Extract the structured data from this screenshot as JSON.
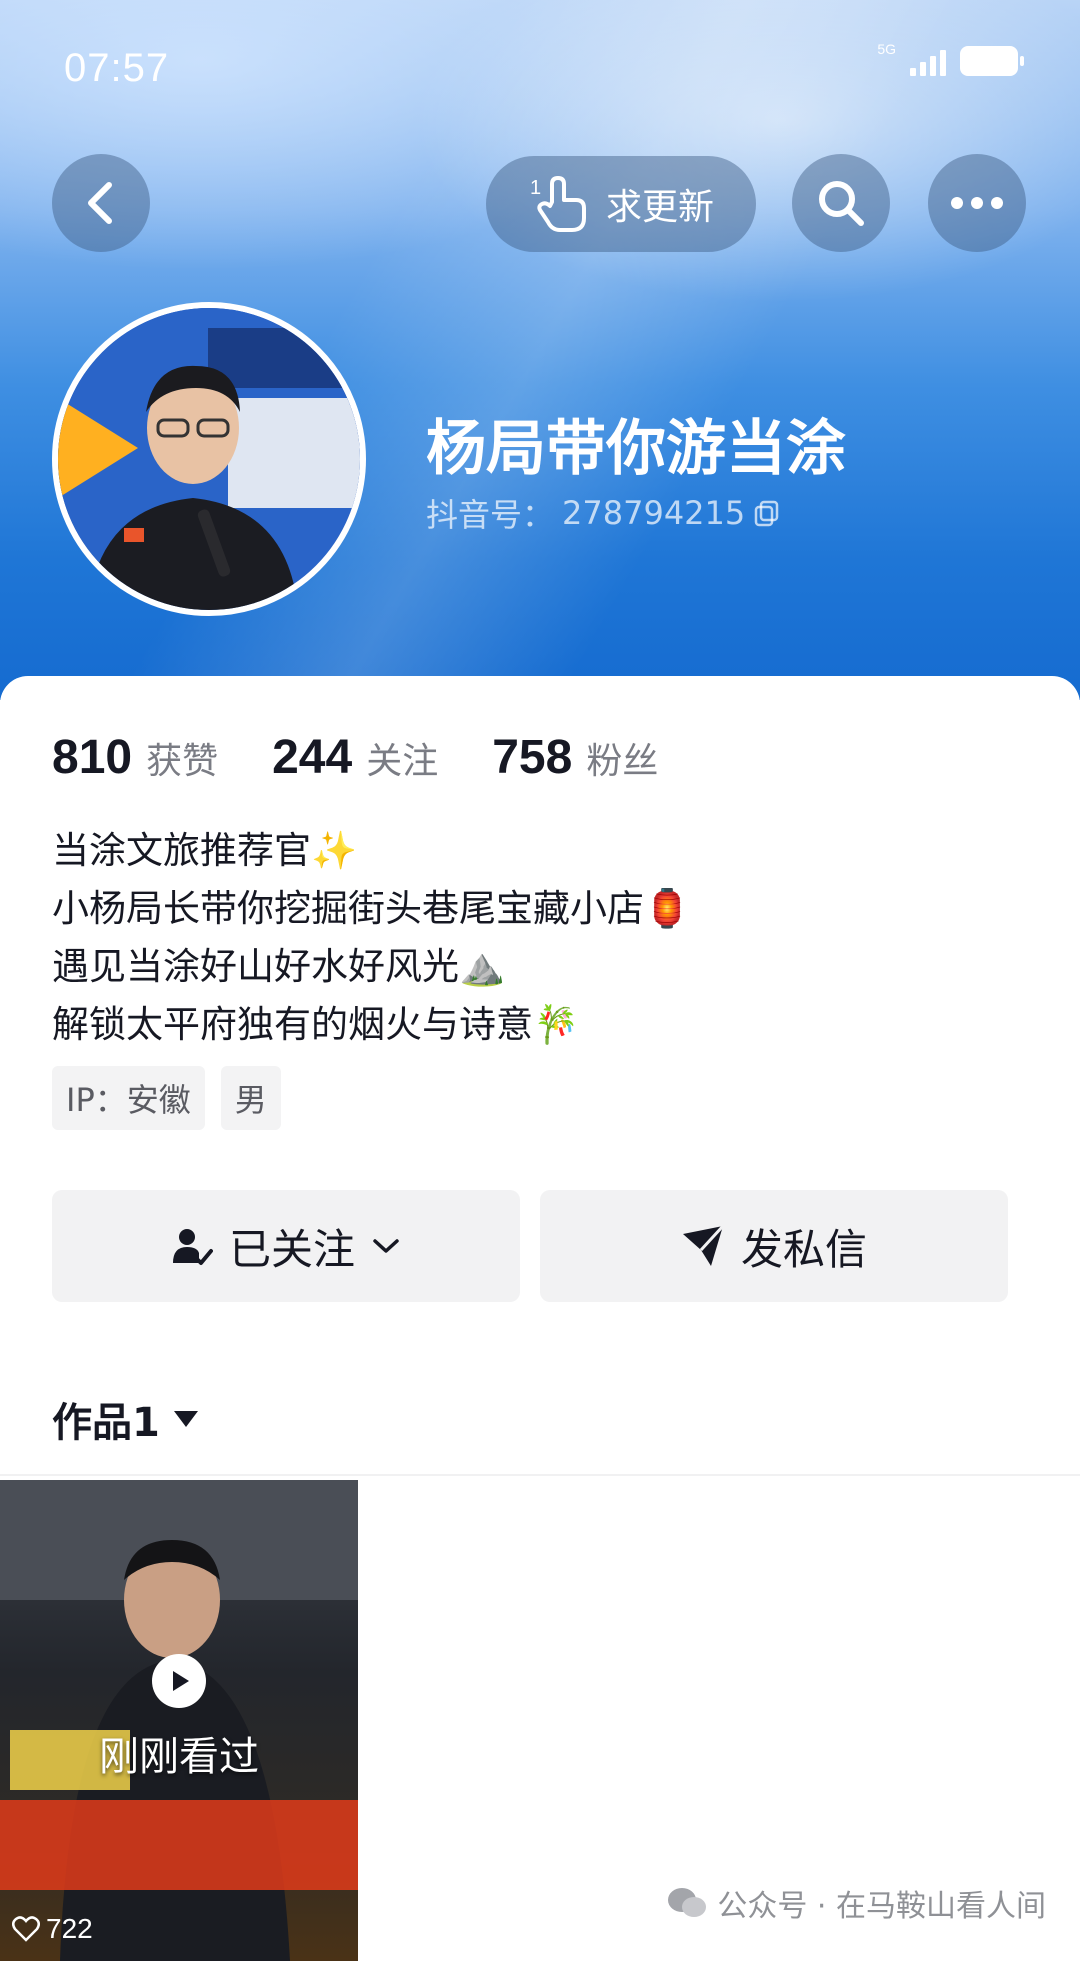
{
  "status_bar": {
    "time": "07:57",
    "network": "5G"
  },
  "top_bar": {
    "request_update_label": "求更新",
    "request_update_badge": "1"
  },
  "profile": {
    "name": "杨局带你游当涂",
    "douyin_id_label": "抖音号：",
    "douyin_id": "278794215"
  },
  "stats": [
    {
      "value": "810",
      "label": "获赞"
    },
    {
      "value": "244",
      "label": "关注"
    },
    {
      "value": "758",
      "label": "粉丝"
    }
  ],
  "bio": [
    "当涂文旅推荐官✨",
    "小杨局长带你挖掘街头巷尾宝藏小店🏮",
    "遇见当涂好山好水好风光⛰️",
    "解锁太平府独有的烟火与诗意🎋"
  ],
  "tags": [
    "IP：安徽",
    "男"
  ],
  "actions": {
    "following_label": "已关注",
    "message_label": "发私信"
  },
  "works_tab": {
    "label": "作品1"
  },
  "video": {
    "overlay_text": "刚刚看过",
    "views": "722"
  },
  "watermark": "公众号 · 在马鞍山看人间",
  "colors": {
    "header_blue": "#1f76d6",
    "text_primary": "#161823",
    "text_secondary": "#7a7c84",
    "button_bg": "#f2f2f3"
  }
}
